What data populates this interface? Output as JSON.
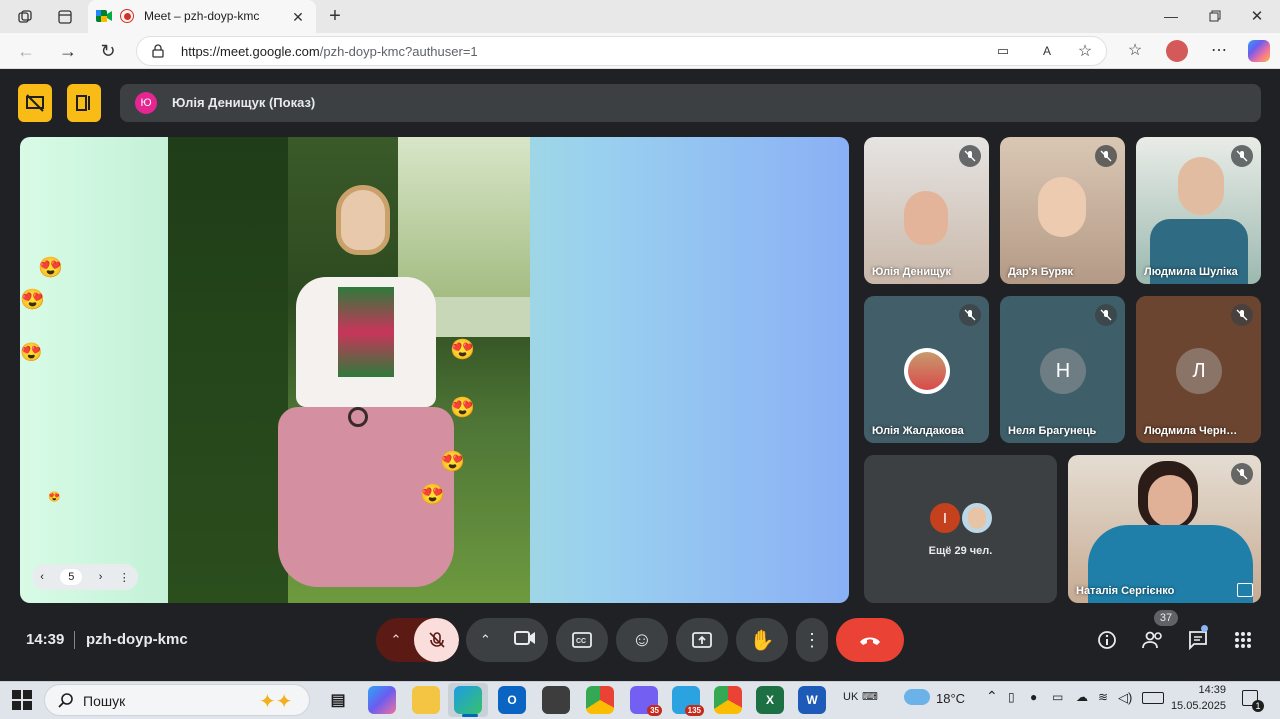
{
  "browser": {
    "tab_title": "Meet – pzh-doyp-kmc",
    "url_host": "https://meet.google.com",
    "url_path": "/pzh-doyp-kmc?authuser=1",
    "new_tab": "+"
  },
  "meet": {
    "presenter_initial": "Ю",
    "presenter_label": "Юлія Денищук (Показ)",
    "slide_page": "5",
    "participants": [
      {
        "name": "Юлія Денищук",
        "mic": "muted"
      },
      {
        "name": "Дар'я Буряк",
        "mic": "muted"
      },
      {
        "name": "Людмила Шуліка",
        "mic": "muted"
      },
      {
        "name": "Юлія Жалдакова",
        "mic": "muted"
      },
      {
        "name": "Неля Брагунець",
        "initial": "Н",
        "mic": "muted"
      },
      {
        "name": "Людмила Черн…",
        "initial": "Л",
        "mic": "muted"
      },
      {
        "name": "Наталія Сергієнко",
        "mic": "muted"
      }
    ],
    "more": {
      "initial": "I",
      "label": "Ещё 29 чел."
    },
    "time": "14:39",
    "meeting_code": "pzh-doyp-kmc",
    "people_count": "37",
    "colors": {
      "background": "#202124",
      "end_call": "#ea4335",
      "mic_off_bg": "#f9dedc",
      "presenter_yellow": "#f9bb16"
    }
  },
  "taskbar": {
    "search": "Пошук",
    "lang": "UK",
    "weather": "18°C",
    "clock_time": "14:39",
    "clock_date": "15.05.2025",
    "viber_badge": "35",
    "telegram_badge": "135",
    "notif_badge": "1"
  }
}
